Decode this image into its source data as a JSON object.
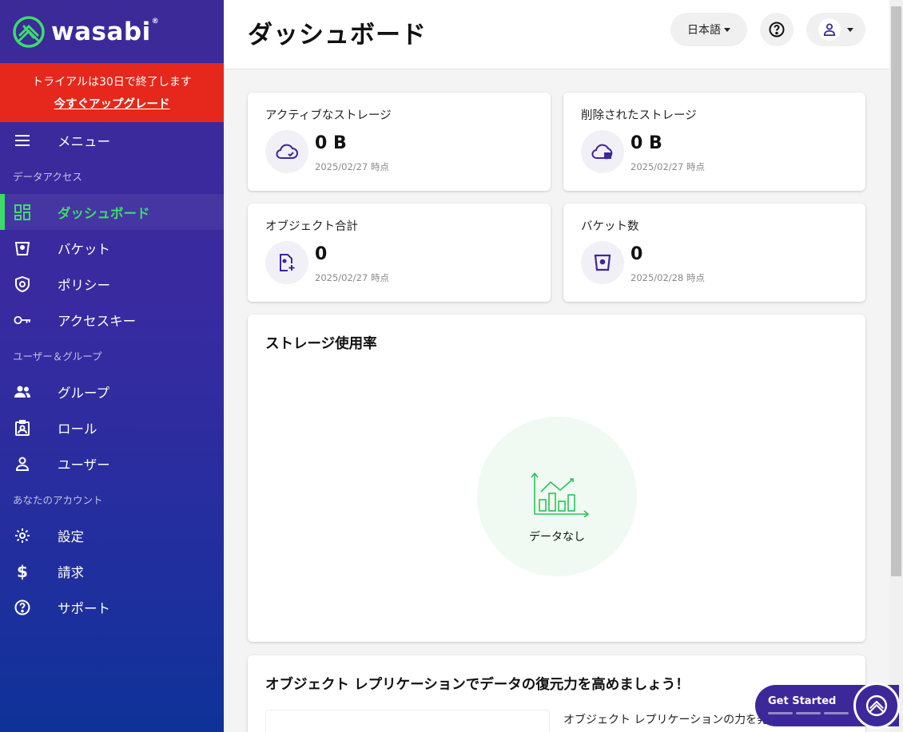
{
  "app": {
    "brand": "wasabi",
    "brand_mark": "®"
  },
  "trial": {
    "notice": "トライアルは30日で終了します",
    "upgrade_link": "今すぐアップグレード"
  },
  "sidebar": {
    "menu_label": "メニュー",
    "sections": {
      "data_access": "データアクセス",
      "users_groups": "ユーザー＆グループ",
      "your_account": "あなたのアカウント"
    },
    "items": {
      "dashboard": "ダッシュボード",
      "buckets": "バケット",
      "policies": "ポリシー",
      "access_keys": "アクセスキー",
      "groups": "グループ",
      "roles": "ロール",
      "users": "ユーザー",
      "settings": "設定",
      "billing": "請求",
      "support": "サポート"
    }
  },
  "header": {
    "title": "ダッシュボード",
    "language": "日本語"
  },
  "stats": [
    {
      "label": "アクティブなストレージ",
      "value": "0 B",
      "date": "2025/02/27 時点"
    },
    {
      "label": "削除されたストレージ",
      "value": "0 B",
      "date": "2025/02/27 時点"
    },
    {
      "label": "オブジェクト合計",
      "value": "0",
      "date": "2025/02/27 時点"
    },
    {
      "label": "バケット数",
      "value": "0",
      "date": "2025/02/28 時点"
    }
  ],
  "storage_usage": {
    "title": "ストレージ使用率",
    "empty_text": "データなし"
  },
  "replication": {
    "title": "オブジェクト レプリケーションでデータの復元力を高めましょう！",
    "text": "オブジェクト レプリケーションの力を発"
  },
  "get_started": {
    "label": "Get Started"
  },
  "colors": {
    "sidebar": "#3c2a98",
    "accent": "#3ddc6a",
    "trial": "#e5281b",
    "icon": "#3d2899"
  }
}
